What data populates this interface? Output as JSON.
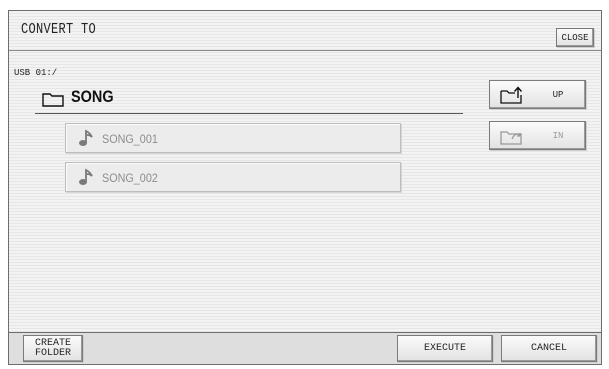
{
  "dialog": {
    "title": "CONVERT TO",
    "close_label": "CLOSE"
  },
  "browser": {
    "path": "USB 01:/",
    "current_folder": "SONG",
    "files": [
      {
        "name": "SONG_001",
        "icon": "music-note-icon"
      },
      {
        "name": "SONG_002",
        "icon": "music-note-icon"
      }
    ]
  },
  "side_buttons": {
    "up_label": "UP",
    "in_label": "IN"
  },
  "bottom_bar": {
    "create_folder_line1": "CREATE",
    "create_folder_line2": "FOLDER",
    "execute_label": "EXECUTE",
    "cancel_label": "CANCEL"
  }
}
